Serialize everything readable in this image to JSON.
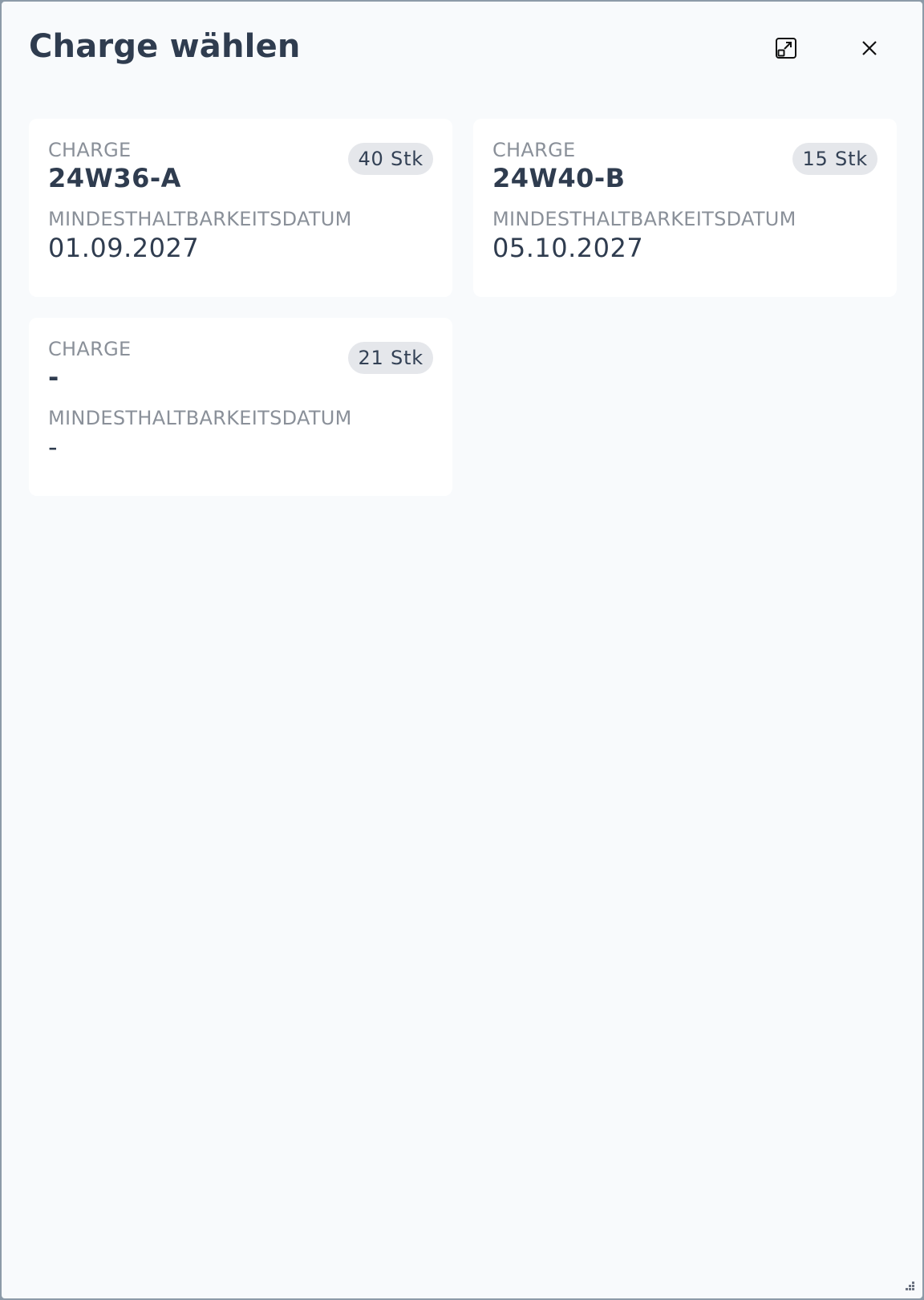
{
  "dialog": {
    "title": "Charge wählen",
    "expand_icon": "expand-icon",
    "close_icon": "close-icon"
  },
  "batches": [
    {
      "charge_label": "CHARGE",
      "charge": "24W36-A",
      "quantity": "40 Stk",
      "mhd_label": "MINDESTHALTBARKEITSDATUM",
      "mhd": "01.09.2027"
    },
    {
      "charge_label": "CHARGE",
      "charge": "24W40-B",
      "quantity": "15 Stk",
      "mhd_label": "MINDESTHALTBARKEITSDATUM",
      "mhd": "05.10.2027"
    },
    {
      "charge_label": "CHARGE",
      "charge": "-",
      "quantity": "21 Stk",
      "mhd_label": "MINDESTHALTBARKEITSDATUM",
      "mhd": "-"
    }
  ],
  "colors": {
    "background": "#f8fafc",
    "card": "#ffffff",
    "text_primary": "#2f3c4f",
    "text_muted": "#8a9099",
    "badge_bg": "#e5e7eb"
  }
}
